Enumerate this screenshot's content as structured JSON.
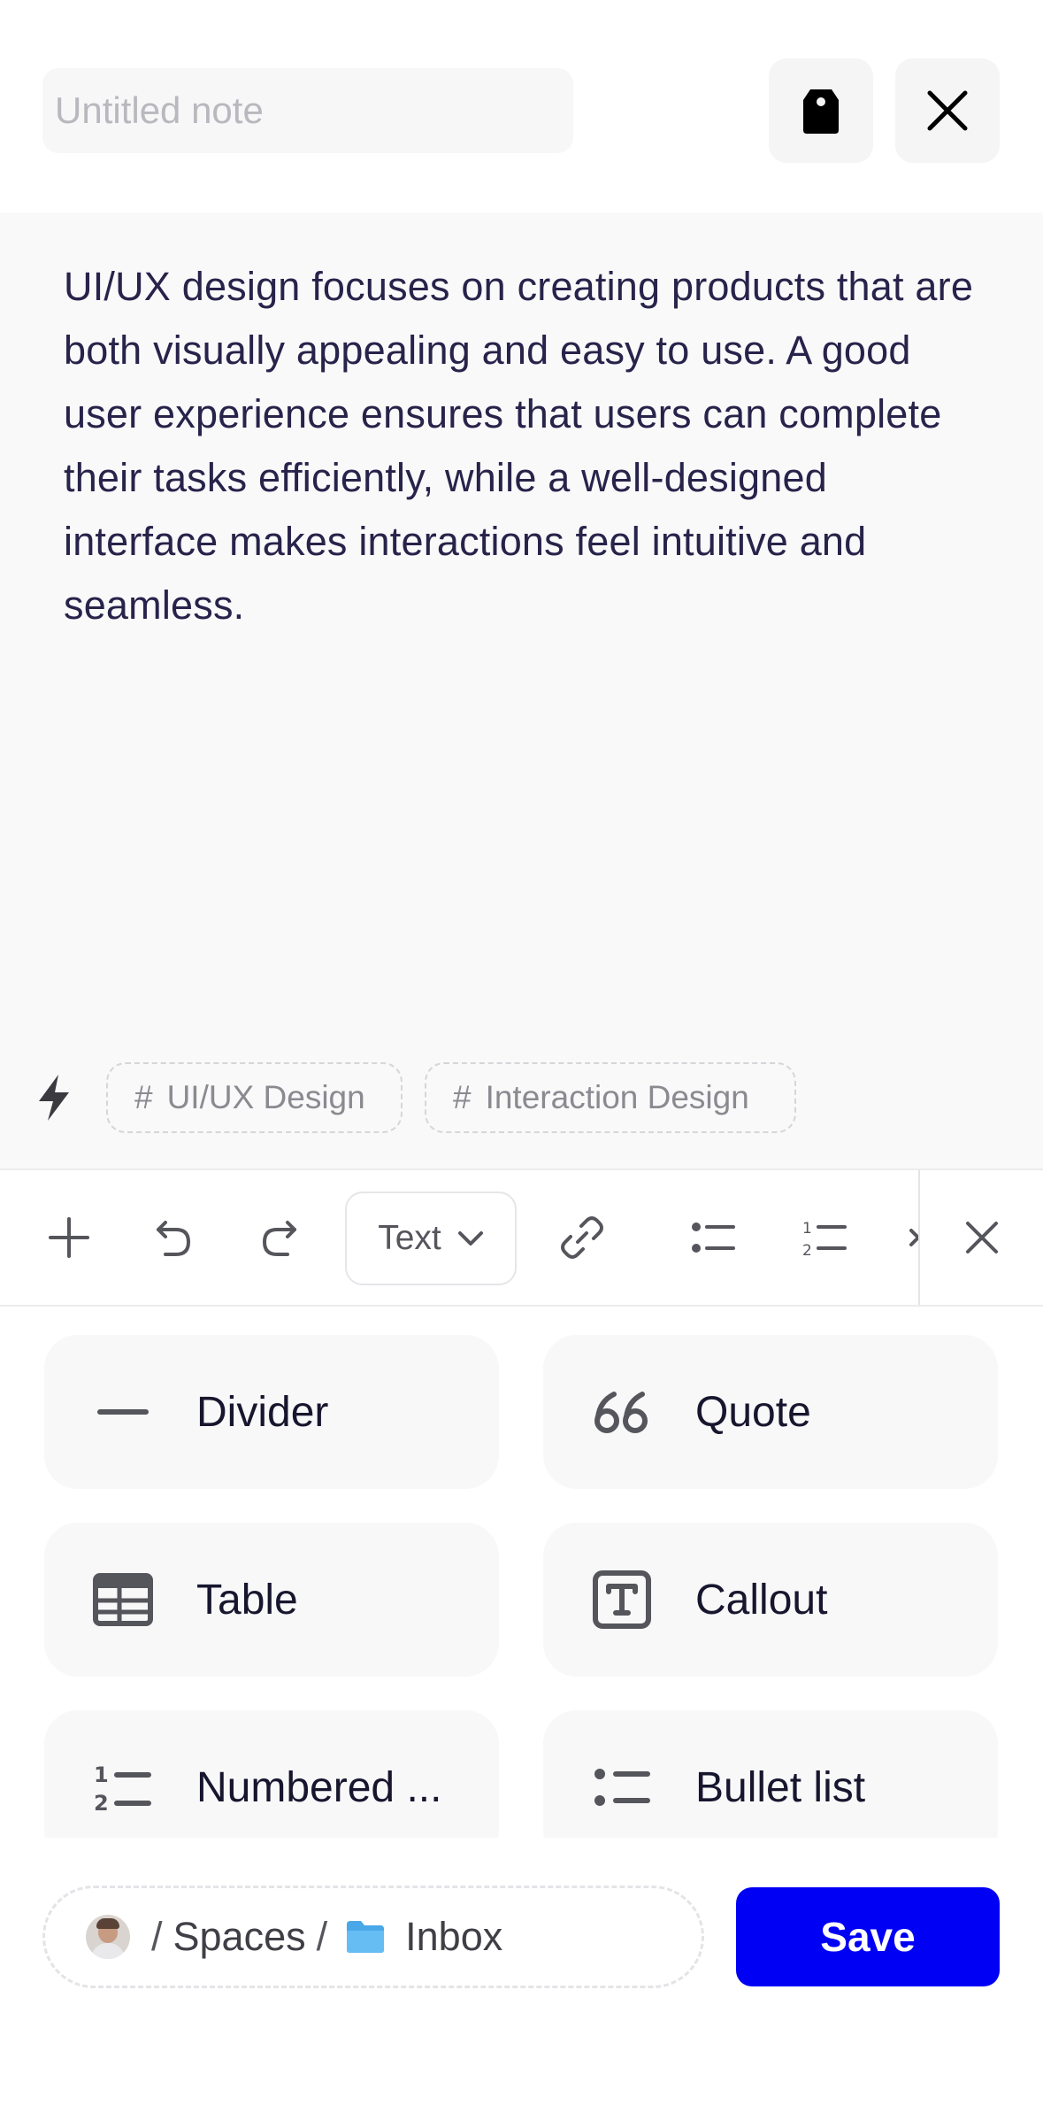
{
  "header": {
    "title_placeholder": "Untitled note",
    "title_value": ""
  },
  "editor": {
    "body_text": "UI/UX design focuses on creating products that are both visually appealing and easy to use. A good user experience ensures that users can complete their tasks efficiently, while a well-designed interface makes interactions feel intuitive and seamless.",
    "tags": [
      {
        "hash": "#",
        "label": "UI/UX Design"
      },
      {
        "hash": "#",
        "label": "Interaction Design"
      }
    ]
  },
  "toolbar": {
    "text_style_label": "Text",
    "icons": [
      "plus-icon",
      "undo-icon",
      "redo-icon",
      "link-icon",
      "bullet-list-icon",
      "numbered-list-icon",
      "close-icon"
    ]
  },
  "blocks": [
    {
      "label": "Divider",
      "icon": "divider-icon"
    },
    {
      "label": "Quote",
      "icon": "quote-icon"
    },
    {
      "label": "Table",
      "icon": "table-icon"
    },
    {
      "label": "Callout",
      "icon": "callout-icon"
    },
    {
      "label": "Numbered ...",
      "icon": "numbered-list-icon"
    },
    {
      "label": "Bullet list",
      "icon": "bullet-list-icon"
    }
  ],
  "footer": {
    "path": {
      "separator": "/",
      "space_label": "Spaces",
      "folder_label": "Inbox"
    },
    "save_label": "Save"
  },
  "colors": {
    "accent": "#0000f5",
    "text_dark": "#27234a",
    "editor_bg": "#f9f9fa",
    "folder_blue": "#4aa8e8"
  }
}
